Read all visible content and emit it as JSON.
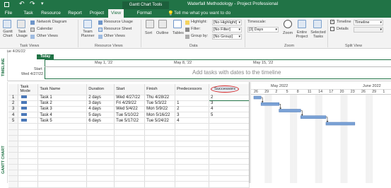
{
  "window": {
    "title": "Waterfall Methodology - Project Professional",
    "context_label": "Gantt Chart Tools",
    "search_placeholder": "Tell me what you want to do"
  },
  "tabs": [
    "File",
    "Task",
    "Resource",
    "Report",
    "Project",
    "View",
    "Format"
  ],
  "active_tab": "View",
  "ribbon": {
    "task_views": {
      "gantt_label": "Gantt Chart",
      "task_usage_label": "Task Usage",
      "network_diagram": "Network Diagram",
      "calendar": "Calendar",
      "other_views": "Other Views",
      "group": "Task Views"
    },
    "resource_views": {
      "team_planner": "Team Planner",
      "resource_usage": "Resource Usage",
      "resource_sheet": "Resource Sheet",
      "other_views": "Other Views",
      "group": "Resource Views"
    },
    "data": {
      "sort": "Sort",
      "outline": "Outline",
      "tables": "Tables",
      "highlight_label": "Highlight:",
      "highlight_value": "[No Highlight]",
      "filter_label": "Filter:",
      "filter_value": "[No Filter]",
      "group_label": "Group by:",
      "group_value": "[No Group]",
      "group": "Data"
    },
    "zoom": {
      "timescale_label": "Timescale:",
      "timescale_value": "[3] Days",
      "zoom": "Zoom",
      "entire_project": "Entire Project",
      "selected_tasks": "Selected Tasks",
      "group": "Zoom"
    },
    "split": {
      "timeline_label": "Timeline",
      "timeline_value": "Timeline",
      "details_label": "Details",
      "group": "Split View"
    }
  },
  "timeline": {
    "side_label": "TIMELINE",
    "today": "Today",
    "start_date_top": "ue 4/26/22",
    "start_label": "Start",
    "start_date": "Wed 4/27/22",
    "date_marks": [
      "May 1, '22",
      "May 8, '22",
      "May 15, '22"
    ],
    "placeholder": "Add tasks with dates to the timeline"
  },
  "side_label": "GANTT CHART",
  "columns": [
    "Task Mode",
    "Task Name",
    "Duration",
    "Start",
    "Finish",
    "Predecessors",
    "Successors"
  ],
  "tasks": [
    {
      "id": "1",
      "name": "Task 1",
      "duration": "2 days",
      "start": "Wed 4/27/22",
      "finish": "Thu 4/28/22",
      "pred": "",
      "succ": "2"
    },
    {
      "id": "2",
      "name": "Task 2",
      "duration": "3 days",
      "start": "Fri 4/29/22",
      "finish": "Tue 5/3/22",
      "pred": "1",
      "succ": "3"
    },
    {
      "id": "3",
      "name": "Task 3",
      "duration": "4 days",
      "start": "Wed 5/4/22",
      "finish": "Mon 5/9/22",
      "pred": "2",
      "succ": "4"
    },
    {
      "id": "4",
      "name": "Task 4",
      "duration": "5 days",
      "start": "Tue 5/10/22",
      "finish": "Mon 5/16/22",
      "pred": "3",
      "succ": "5"
    },
    {
      "id": "5",
      "name": "Task 5",
      "duration": "6 days",
      "start": "Tue 5/17/22",
      "finish": "Tue 5/24/22",
      "pred": "4",
      "succ": ""
    }
  ],
  "gantt": {
    "month1": "May 2022",
    "month2": "June 2022",
    "days": [
      "26",
      "29",
      "2",
      "5",
      "8",
      "11",
      "14",
      "17",
      "20",
      "23",
      "26",
      "29",
      "1"
    ]
  }
}
